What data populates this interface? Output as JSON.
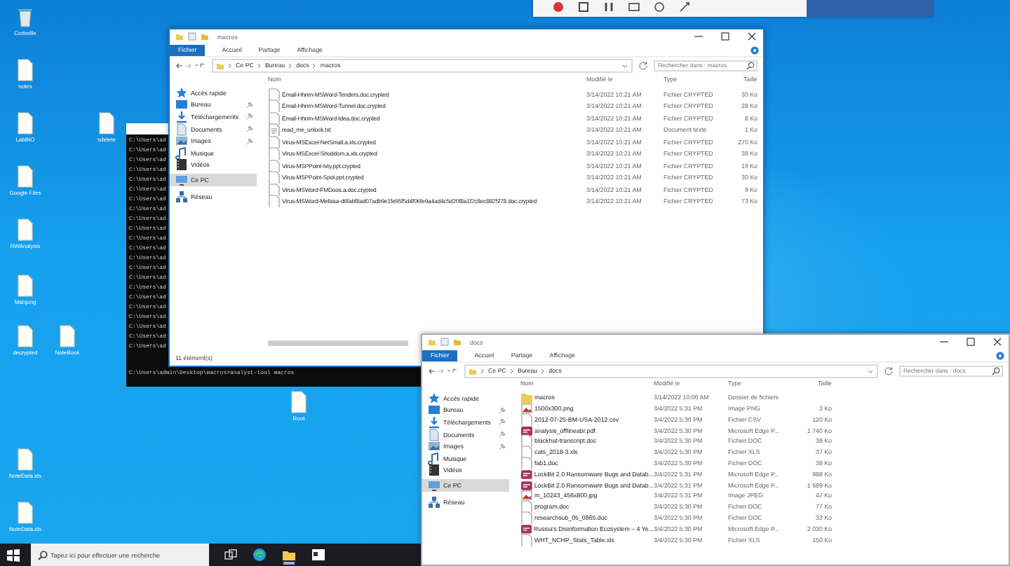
{
  "desktop_icons": [
    {
      "label": "Corbeille",
      "kind": "bin"
    },
    {
      "label": "notes",
      "kind": "file"
    },
    {
      "label": "LabBIO",
      "kind": "file"
    },
    {
      "label": "sdelete",
      "kind": "file"
    },
    {
      "label": "Google Files",
      "kind": "file"
    },
    {
      "label": "RWAnalysis",
      "kind": "file"
    },
    {
      "label": "Mahjong",
      "kind": "file"
    },
    {
      "label": "decrypted",
      "kind": "file"
    },
    {
      "label": "NoteBook",
      "kind": "file"
    },
    {
      "label": "Root",
      "kind": "file"
    },
    {
      "label": "NoteData.xls",
      "kind": "file"
    },
    {
      "label": "NoteData.xls",
      "kind": "file"
    }
  ],
  "terminal": {
    "lines": [
      "C:\\Users\\ad",
      "C:\\Users\\ad",
      "C:\\Users\\ad",
      "C:\\Users\\ad",
      "C:\\Users\\ad",
      "C:\\Users\\ad",
      "C:\\Users\\ad",
      "C:\\Users\\ad",
      "C:\\Users\\ad",
      "C:\\Users\\ad",
      "C:\\Users\\ad",
      "C:\\Users\\ad",
      "C:\\Users\\ad",
      "C:\\Users\\ad",
      "C:\\Users\\ad",
      "C:\\Users\\ad",
      "C:\\Users\\ad",
      "C:\\Users\\ad",
      "C:\\Users\\ad",
      "C:\\Users\\ad",
      "C:\\Users\\ad",
      "C:\\Users\\ad",
      "C:\\Users\\admin\\Desktop\\macros>analyst-tool macros"
    ]
  },
  "windows": [
    {
      "title": "macros",
      "file_menu": "Fichier",
      "ribbon_tabs": [
        "Accueil",
        "Partage",
        "Affichage"
      ],
      "breadcrumb": [
        "Ce PC",
        "Bureau",
        "docs",
        "macros"
      ],
      "search": {
        "placeholder": "Rechercher dans : macros"
      },
      "sidebar": [
        {
          "label": "Accès rapide",
          "kind": "star",
          "pinned": false,
          "selected": false
        },
        {
          "label": "Bureau",
          "kind": "desktop",
          "pinned": true,
          "selected": false
        },
        {
          "label": "Téléchargements",
          "kind": "download",
          "pinned": true,
          "selected": false
        },
        {
          "label": "Documents",
          "kind": "doc",
          "pinned": true,
          "selected": false
        },
        {
          "label": "Images",
          "kind": "image",
          "pinned": true,
          "selected": false
        },
        {
          "label": "Musique",
          "kind": "music",
          "pinned": false,
          "selected": false
        },
        {
          "label": "Vidéos",
          "kind": "video",
          "pinned": false,
          "selected": false
        },
        {
          "label": "Ce PC",
          "kind": "pc",
          "pinned": false,
          "selected": true
        },
        {
          "label": "Réseau",
          "kind": "network",
          "pinned": false,
          "selected": false
        }
      ],
      "columns": [
        "Nom",
        "Modifié le",
        "Type",
        "Taille"
      ],
      "rows": [
        {
          "kind": "file",
          "name": "Email-Hhnm-MSWord-Tenders.doc.crypted",
          "modified": "3/14/2022 10:21 AM",
          "type": "Fichier CRYPTED",
          "size": "30 Ko"
        },
        {
          "kind": "file",
          "name": "Email-Hhnm-MSWord-Tunnel.doc.crypted",
          "modified": "3/14/2022 10:21 AM",
          "type": "Fichier CRYPTED",
          "size": "28 Ko"
        },
        {
          "kind": "file",
          "name": "Email-Hhnm-MSWord-Idea.doc.crypted",
          "modified": "3/14/2022 10:21 AM",
          "type": "Fichier CRYPTED",
          "size": "8 Ko"
        },
        {
          "kind": "text",
          "name": "read_me_unlock.txt",
          "modified": "3/14/2022 10:21 AM",
          "type": "Document texte",
          "size": "1 Ko"
        },
        {
          "kind": "file",
          "name": "Virus-MSExcel-NetSmall.a.xls.crypted",
          "modified": "3/14/2022 10:21 AM",
          "type": "Fichier CRYPTED",
          "size": "270 Ko"
        },
        {
          "kind": "file",
          "name": "Virus-MSExcel-Shoddom.a.xls.crypted",
          "modified": "3/14/2022 10:21 AM",
          "type": "Fichier CRYPTED",
          "size": "38 Ko"
        },
        {
          "kind": "file",
          "name": "Virus-MSPPoint-Ivty.ppt.crypted",
          "modified": "3/14/2022 10:21 AM",
          "type": "Fichier CRYPTED",
          "size": "19 Ko"
        },
        {
          "kind": "file",
          "name": "Virus-MSPPoint-Spot.ppt.crypted",
          "modified": "3/14/2022 10:21 AM",
          "type": "Fichier CRYPTED",
          "size": "30 Ko"
        },
        {
          "kind": "file",
          "name": "Virus-MSWord-FMDoos.a.doc.crypted",
          "modified": "3/14/2022 10:21 AM",
          "type": "Fichier CRYPTED",
          "size": "9 Ko"
        },
        {
          "kind": "file",
          "name": "Virus-MSWord-Melissa-d6fabf8ad07adb9e1fe95f5d4f06fe9a4ad4c5d20f8a1f2c8ec8825f78.doc.crypted",
          "modified": "3/14/2022 10:21 AM",
          "type": "Fichier CRYPTED",
          "size": "73 Ko"
        }
      ],
      "status": "11 élément(s)"
    },
    {
      "title": "docs",
      "file_menu": "Fichier",
      "ribbon_tabs": [
        "Accueil",
        "Partage",
        "Affichage"
      ],
      "breadcrumb": [
        "Ce PC",
        "Bureau",
        "docs"
      ],
      "search": {
        "placeholder": "Rechercher dans : docs"
      },
      "sidebar": [
        {
          "label": "Accès rapide",
          "kind": "star",
          "pinned": false,
          "selected": false
        },
        {
          "label": "Bureau",
          "kind": "desktop",
          "pinned": true,
          "selected": false
        },
        {
          "label": "Téléchargements",
          "kind": "download",
          "pinned": true,
          "selected": false
        },
        {
          "label": "Documents",
          "kind": "doc",
          "pinned": true,
          "selected": false
        },
        {
          "label": "Images",
          "kind": "image",
          "pinned": true,
          "selected": false
        },
        {
          "label": "Musique",
          "kind": "music",
          "pinned": false,
          "selected": false
        },
        {
          "label": "Vidéos",
          "kind": "video",
          "pinned": false,
          "selected": false
        },
        {
          "label": "Ce PC",
          "kind": "pc",
          "pinned": false,
          "selected": true
        },
        {
          "label": "Réseau",
          "kind": "network",
          "pinned": false,
          "selected": false
        }
      ],
      "columns": [
        "Nom",
        "Modifié le",
        "Type",
        "Taille"
      ],
      "rows": [
        {
          "kind": "folder",
          "name": "macros",
          "modified": "3/14/2022 10:06 AM",
          "type": "Dossier de fichiers"
        },
        {
          "kind": "image",
          "name": "1500x300.png",
          "modified": "3/4/2022 5:31 PM",
          "type": "Image PNG",
          "size": "3 Ko"
        },
        {
          "kind": "file",
          "name": "2012-07-25-BM-USA-2012.csv",
          "modified": "3/4/2022 5:30 PM",
          "type": "Fichier CSV",
          "size": "120 Ko"
        },
        {
          "kind": "pdf",
          "name": "analysis_offlineabr.pdf",
          "modified": "3/4/2022 5:30 PM",
          "type": "Microsoft Edge P...",
          "size": "1 740 Ko"
        },
        {
          "kind": "file",
          "name": "blackhat-transcript.doc",
          "modified": "3/4/2022 5:30 PM",
          "type": "Fichier DOC",
          "size": "38 Ko"
        },
        {
          "kind": "file",
          "name": "cats_2018-3.xls",
          "modified": "3/4/2022 5:30 PM",
          "type": "Fichier XLS",
          "size": "37 Ko"
        },
        {
          "kind": "file",
          "name": "fab1.doc",
          "modified": "3/4/2022 5:30 PM",
          "type": "Fichier DOC",
          "size": "38 Ko"
        },
        {
          "kind": "pdf",
          "name": "LockBit 2.0 Ransomware Bugs and Datab...",
          "modified": "3/4/2022 5:31 PM",
          "type": "Microsoft Edge P...",
          "size": "988 Ko"
        },
        {
          "kind": "pdf",
          "name": "LockBit 2.0 Ransomware Bugs and Datab...",
          "modified": "3/4/2022 5:31 PM",
          "type": "Microsoft Edge P...",
          "size": "1 689 Ko"
        },
        {
          "kind": "image",
          "name": "m_10243_456x800.jpg",
          "modified": "3/4/2022 5:31 PM",
          "type": "Image JPEG",
          "size": "47 Ko"
        },
        {
          "kind": "file",
          "name": "program.doc",
          "modified": "3/4/2022 5:30 PM",
          "type": "Fichier DOC",
          "size": "77 Ko"
        },
        {
          "kind": "file",
          "name": "researchsub_05_0865.doc",
          "modified": "3/4/2022 5:30 PM",
          "type": "Fichier DOC",
          "size": "33 Ko"
        },
        {
          "kind": "pdf",
          "name": "Russia's Disinformation Ecosystem – 4 Ye...",
          "modified": "3/4/2022 5:30 PM",
          "type": "Microsoft Edge P...",
          "size": "2 030 Ko"
        },
        {
          "kind": "file",
          "name": "WHT_NCHP_Stats_Table.xls",
          "modified": "3/4/2022 5:30 PM",
          "type": "Fichier XLS",
          "size": "150 Ko"
        }
      ]
    }
  ],
  "taskbar": {
    "search": {
      "placeholder": "Tapez ici pour effectuer une recherche"
    }
  }
}
